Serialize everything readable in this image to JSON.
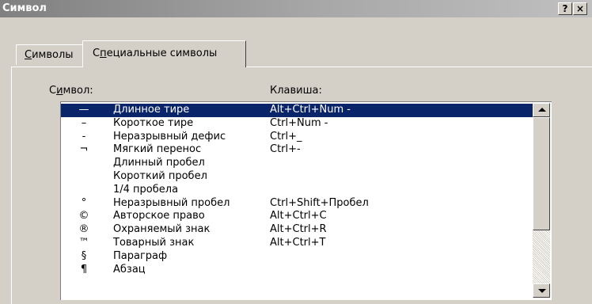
{
  "window": {
    "title": "Символ",
    "help_button": "?",
    "close_button": "×"
  },
  "tabs": [
    {
      "hotkey": "С",
      "rest": "имволы",
      "active": false
    },
    {
      "pre": "С",
      "hotkey": "п",
      "rest": "ециальные символы",
      "active": true
    }
  ],
  "columns": {
    "symbol_pre": "С",
    "symbol_hotkey": "и",
    "symbol_rest": "мвол:",
    "key": "Клавиша:"
  },
  "rows": [
    {
      "symbol": "—",
      "name": "Длинное тире",
      "key": "Alt+Ctrl+Num -",
      "selected": true
    },
    {
      "symbol": "–",
      "name": "Короткое тире",
      "key": "Ctrl+Num -"
    },
    {
      "symbol": "-",
      "name": "Неразрывный дефис",
      "key": "Ctrl+_"
    },
    {
      "symbol": "¬",
      "name": "Мягкий перенос",
      "key": "Ctrl+-"
    },
    {
      "symbol": "",
      "name": "Длинный пробел",
      "key": ""
    },
    {
      "symbol": "",
      "name": "Короткий пробел",
      "key": ""
    },
    {
      "symbol": "",
      "name": "1/4 пробела",
      "key": ""
    },
    {
      "symbol": "°",
      "name": "Неразрывный пробел",
      "key": "Ctrl+Shift+Пробел"
    },
    {
      "symbol": "©",
      "name": "Авторское право",
      "key": "Alt+Ctrl+C"
    },
    {
      "symbol": "®",
      "name": "Охраняемый знак",
      "key": "Alt+Ctrl+R"
    },
    {
      "symbol": "™",
      "name": "Товарный знак",
      "key": "Alt+Ctrl+T"
    },
    {
      "symbol": "§",
      "name": "Параграф",
      "key": ""
    },
    {
      "symbol": "¶",
      "name": "Абзац",
      "key": ""
    }
  ],
  "icons": {
    "scroll_up": "triangle-up",
    "scroll_down": "triangle-down"
  },
  "colors": {
    "selection_bg": "#0a246a",
    "dialog_bg": "#d4d0c8"
  },
  "scroll": {
    "thumb_fraction": 0.68,
    "position": 0.0
  }
}
